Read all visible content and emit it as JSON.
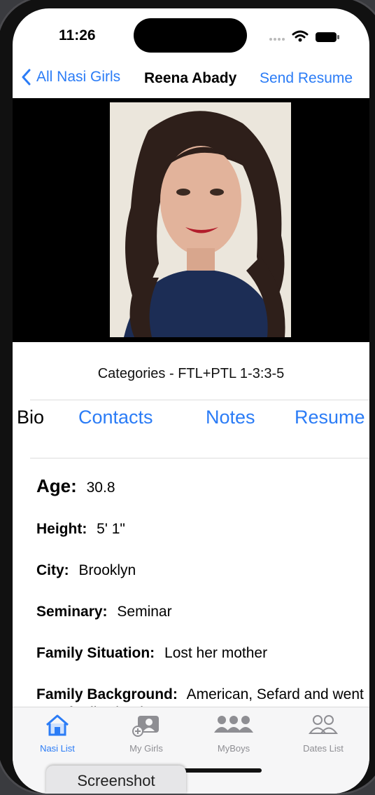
{
  "status": {
    "time": "11:26"
  },
  "nav": {
    "back_label": "All Nasi Girls",
    "title": "Reena Abady",
    "action_label": "Send Resume"
  },
  "profile": {
    "categories": "Categories - FTL+PTL 1-3:3-5"
  },
  "tabs": [
    {
      "label": "Bio",
      "selected": true
    },
    {
      "label": "Contacts"
    },
    {
      "label": "Notes"
    },
    {
      "label": "Resume"
    }
  ],
  "details": [
    {
      "label": "Age:",
      "value": "30.8"
    },
    {
      "label": "Height:",
      "value": "5' 1\""
    },
    {
      "label": "City:",
      "value": "Brooklyn"
    },
    {
      "label": "Seminary:",
      "value": "Seminar"
    },
    {
      "label": "Family Situation:",
      "value": "Lost her mother"
    },
    {
      "label": "Family Background:",
      "value": "American, Sefard and went to sefardi schools"
    }
  ],
  "tab_bar": [
    {
      "label": "Nasi List",
      "icon": "house-icon",
      "active": true
    },
    {
      "label": "My Girls",
      "icon": "person-card-icon"
    },
    {
      "label": "MyBoys",
      "icon": "three-people-icon"
    },
    {
      "label": "Dates List",
      "icon": "two-people-outline-icon"
    }
  ],
  "overlay": {
    "screenshot_label": "Screenshot"
  },
  "colors": {
    "accent": "#2b7cf6",
    "inactive": "#8e8e93"
  }
}
